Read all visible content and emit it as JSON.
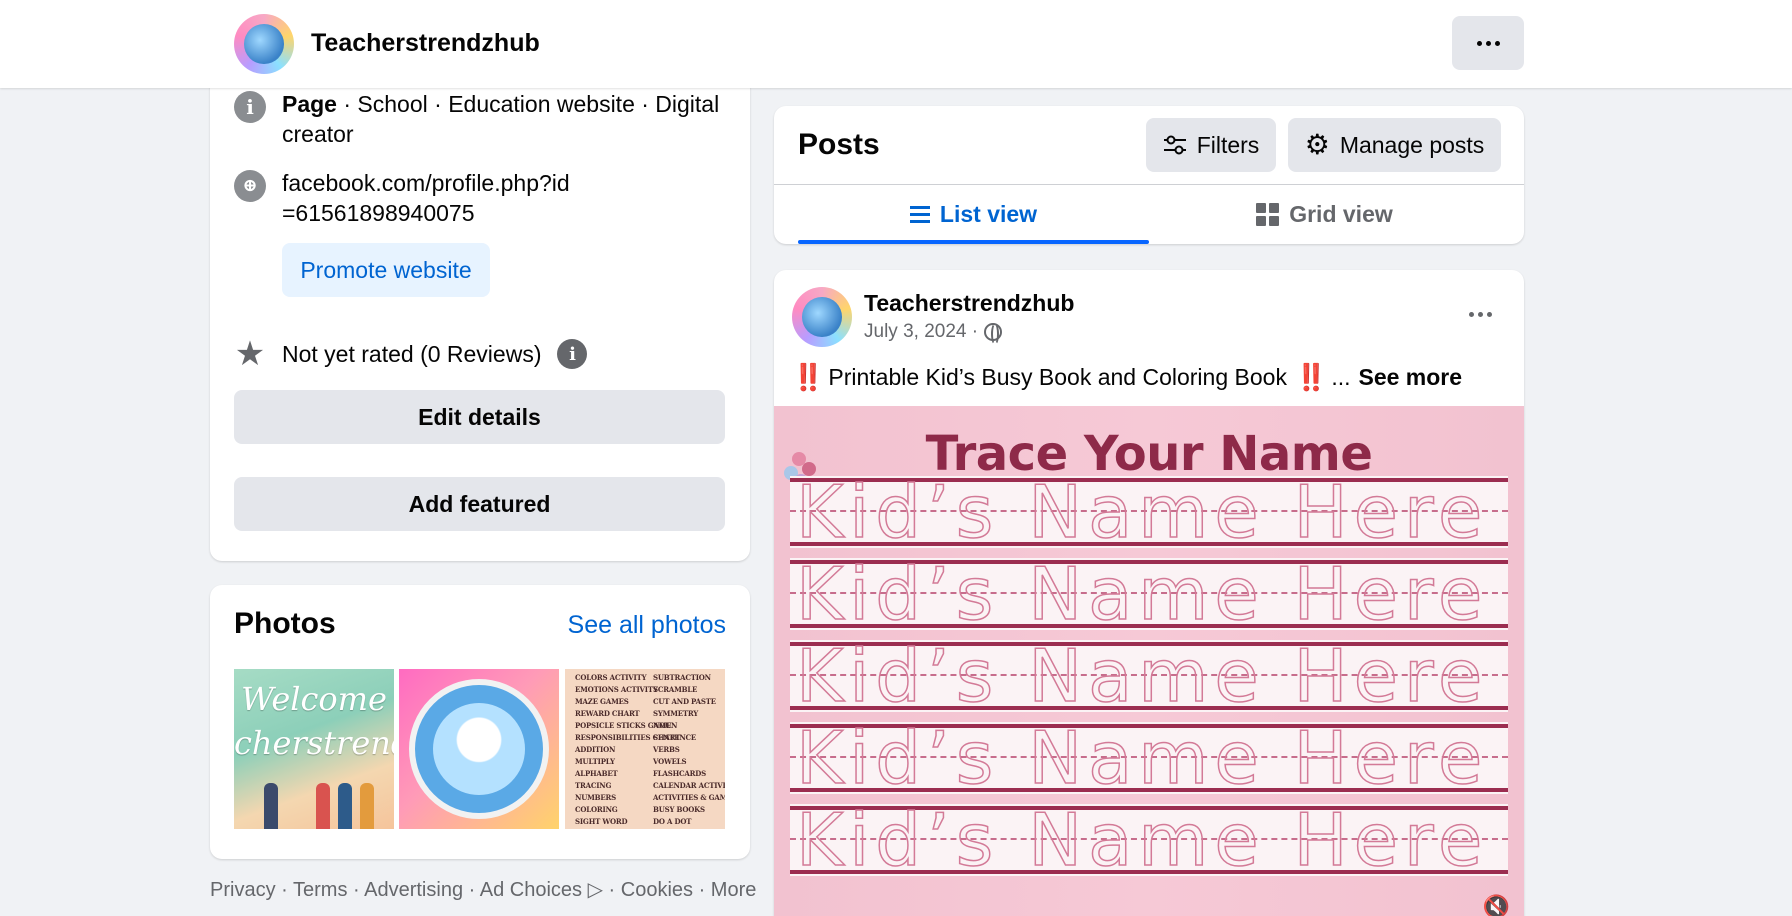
{
  "header": {
    "page_name": "Teacherstrendzhub",
    "more_button_label": "More options"
  },
  "intro": {
    "category_prefix": "Page",
    "category_rest": " · School · Education website · Digital creator",
    "website": "facebook.com/profile.php?id=61561898940075",
    "promote_label": "Promote website",
    "rating": "Not yet rated (0 Reviews)",
    "edit_details_label": "Edit details",
    "add_featured_label": "Add featured"
  },
  "photos": {
    "title": "Photos",
    "see_all_label": "See all photos",
    "thumb1_text": "Welcome",
    "thumb1_text2": "cherstrendz",
    "thumb3_labels_left": [
      "COLORS ACTIVITY",
      "EMOTIONS ACTIVITY",
      "MAZE GAMES",
      "REWARD CHART",
      "POPSICLE STICKS GAME",
      "RESPONSIBILITIES CHART",
      "ADDITION",
      "MULTIPLY",
      "ALPHABET",
      "TRACING",
      "NUMBERS",
      "COLORING",
      "SIGHT WORD"
    ],
    "thumb3_labels_right": [
      "SUBTRACTION",
      "SCRAMBLE",
      "CUT AND PASTE",
      "SYMMETRY",
      "NOUN",
      "SENTENCE",
      "VERBS",
      "VOWELS",
      "FLASHCARDS",
      "CALENDAR ACTIVITY",
      "ACTIVITIES & GAMES",
      "BUSY BOOKS",
      "DO A DOT"
    ]
  },
  "footer": {
    "links": [
      "Privacy",
      "Terms",
      "Advertising",
      "Ad Choices",
      "Cookies",
      "More"
    ]
  },
  "posts": {
    "title": "Posts",
    "filters_label": "Filters",
    "manage_label": "Manage posts",
    "tab_list": "List view",
    "tab_grid": "Grid view"
  },
  "post": {
    "author": "Teacherstrendzhub",
    "date": "July 3, 2024 ·",
    "bang": "‼️",
    "text": "Printable Kid’s Busy Book and Coloring Book",
    "ellipsis": "...",
    "see_more": "See more",
    "image_title": "Trace Your Name",
    "trace_text": "Kid’s Name Here"
  },
  "colors": {
    "accent": "#0866ff",
    "link": "#0064d1",
    "background": "#f0f2f5",
    "button_grey": "#e4e6eb",
    "trace_title": "#8e2a49"
  },
  "icons": [
    "info-icon",
    "globe-icon",
    "star-icon",
    "filters-icon",
    "gear-icon",
    "list-icon",
    "grid-icon",
    "privacy-ad-choices-icon",
    "speaker-muted-icon"
  ]
}
